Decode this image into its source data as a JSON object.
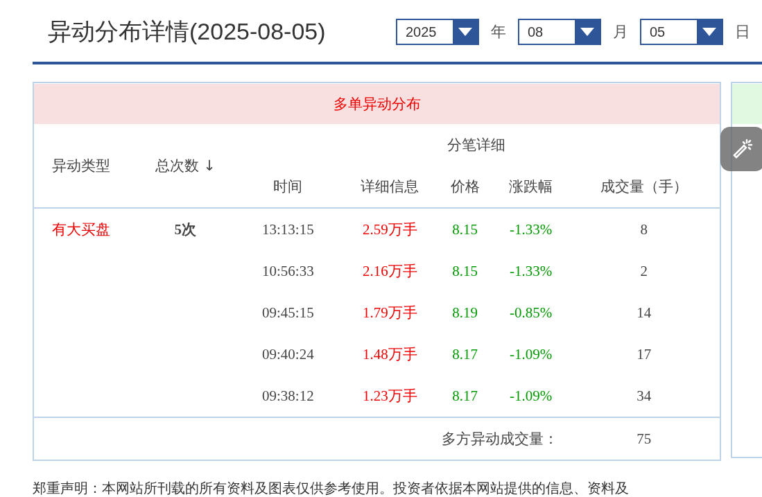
{
  "title": "异动分布详情(2025-08-05)",
  "date_selects": [
    {
      "value": "2025",
      "unit": "年"
    },
    {
      "value": "08",
      "unit": "月"
    },
    {
      "value": "05",
      "unit": "日"
    }
  ],
  "panel": {
    "header": "多单异动分布",
    "group_header": "分笔详细",
    "columns": [
      {
        "label": "异动类型"
      },
      {
        "label": "总次数",
        "sort_indicator": "↓"
      },
      {
        "label": "时间"
      },
      {
        "label": "详细信息"
      },
      {
        "label": "价格"
      },
      {
        "label": "涨跌幅"
      },
      {
        "label": "成交量（手）"
      }
    ],
    "rows": [
      {
        "type": "有大买盘",
        "count": "5次",
        "trades": [
          {
            "time": "13:13:15",
            "detail": "2.59万手",
            "price": "8.15",
            "change": "-1.33%",
            "volume": "8"
          },
          {
            "time": "10:56:33",
            "detail": "2.16万手",
            "price": "8.15",
            "change": "-1.33%",
            "volume": "2"
          },
          {
            "time": "09:45:15",
            "detail": "1.79万手",
            "price": "8.19",
            "change": "-0.85%",
            "volume": "14"
          },
          {
            "time": "09:40:24",
            "detail": "1.48万手",
            "price": "8.17",
            "change": "-1.09%",
            "volume": "17"
          },
          {
            "time": "09:38:12",
            "detail": "1.23万手",
            "price": "8.17",
            "change": "-1.09%",
            "volume": "34"
          }
        ]
      }
    ],
    "footer": {
      "label": "多方异动成交量：",
      "value": "75"
    }
  },
  "disclaimer": "郑重声明：本网站所刊载的所有资料及图表仅供参考使用。投资者依据本网站提供的信息、资料及"
}
